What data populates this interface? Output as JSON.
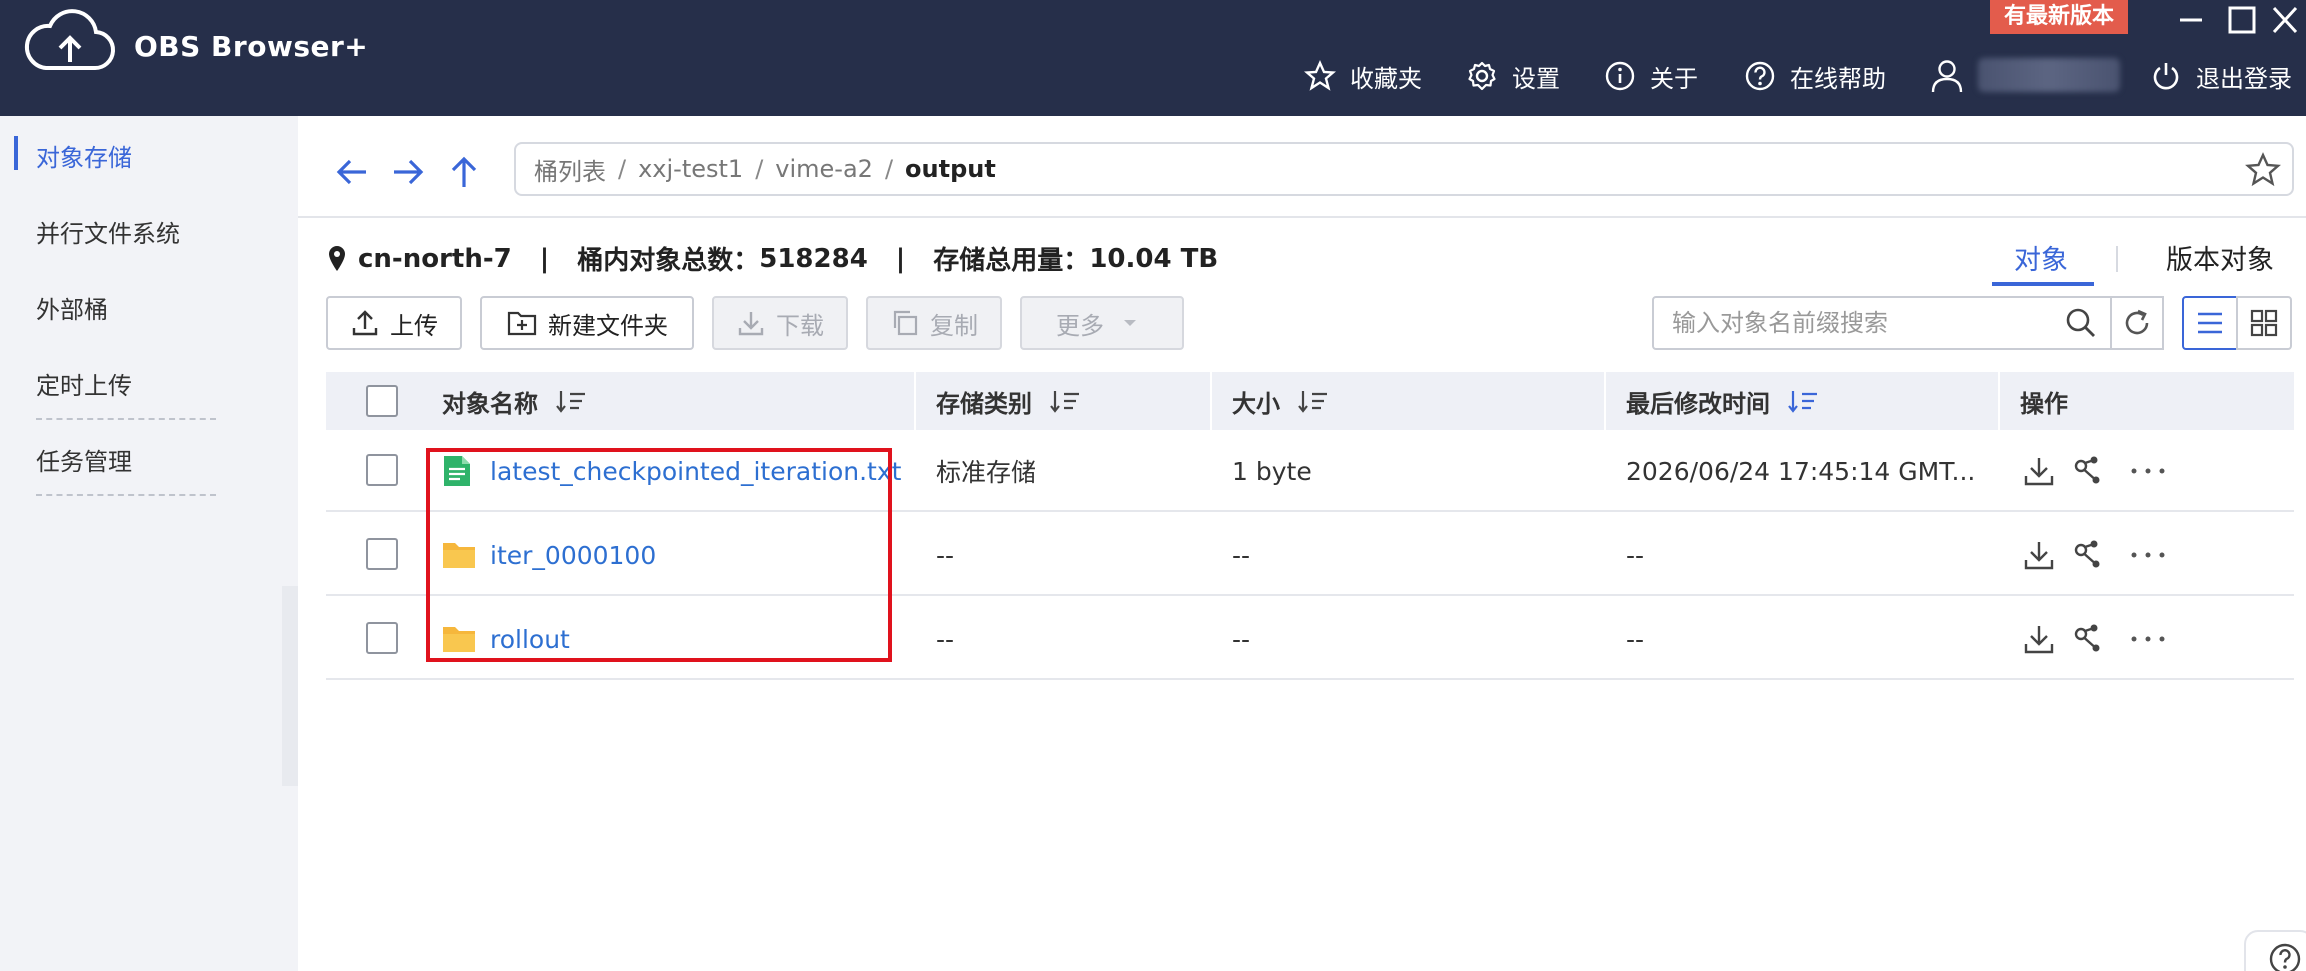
{
  "app": {
    "title": "OBS Browser+",
    "update_badge": "有最新版本"
  },
  "topnav": {
    "favorites": "收藏夹",
    "settings": "设置",
    "about": "关于",
    "help": "在线帮助",
    "logout": "退出登录"
  },
  "sidebar": {
    "items": [
      {
        "label": "对象存储",
        "active": true
      },
      {
        "label": "并行文件系统",
        "active": false
      },
      {
        "label": "外部桶",
        "active": false
      },
      {
        "label": "定时上传",
        "active": false
      },
      {
        "label": "任务管理",
        "active": false
      }
    ]
  },
  "breadcrumb": {
    "items": [
      "桶列表",
      "xxj-test1",
      "vime-a2"
    ],
    "current": "output",
    "separator": "/"
  },
  "info": {
    "region": "cn-north-7",
    "object_count_label": "桶内对象总数：",
    "object_count": "518284",
    "storage_label": "存储总用量：",
    "storage_used": "10.04 TB",
    "pipe": "|"
  },
  "tabs": {
    "objects": "对象",
    "versions": "版本对象"
  },
  "toolbar": {
    "upload": "上传",
    "new_folder": "新建文件夹",
    "download": "下载",
    "copy": "复制",
    "more": "更多"
  },
  "search": {
    "placeholder": "输入对象名前缀搜索"
  },
  "table": {
    "columns": {
      "name": "对象名称",
      "storage_class": "存储类别",
      "size": "大小",
      "modified": "最后修改时间",
      "actions": "操作"
    },
    "rows": [
      {
        "name": "latest_checkpointed_iteration.txt",
        "type": "file",
        "storage_class": "标准存储",
        "size": "1 byte",
        "modified": "2026/06/24 17:45:14 GMT..."
      },
      {
        "name": "iter_0000100",
        "type": "folder",
        "storage_class": "--",
        "size": "--",
        "modified": "--"
      },
      {
        "name": "rollout",
        "type": "folder",
        "storage_class": "--",
        "size": "--",
        "modified": "--"
      }
    ]
  },
  "colors": {
    "titlebar": "#262f4a",
    "accent": "#3a66d8",
    "link": "#2d6fd1",
    "highlight": "#e0121d",
    "badge": "#e35c4c"
  }
}
